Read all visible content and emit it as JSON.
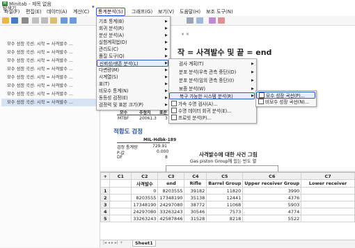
{
  "window": {
    "title": "Minitab - 제목 없음",
    "app_icon": "minitab-logo-icon"
  },
  "menu": [
    "파일(F)",
    "편집(E)",
    "데이터(A)",
    "계산(C)",
    "통계분석(S)",
    "그래프(G)",
    "보기(V)",
    "도움말(H)",
    "보조 도구(N)"
  ],
  "explorer": {
    "title": "탐색기",
    "items": [
      "모수 성장 곡선: 시작 = 사격발수 ...",
      "모수 성장 곡선: 시작 = 사격발수 ...",
      "모수 성장 곡선: 시작 = 사격발수 ...",
      "모수 성장 곡선: 시작 = 사격발수 ...",
      "모수 성장 곡선: 시작 = 사격발수 ...",
      "모수 성장 곡선: 시작 = 사격발수 ...",
      "모수 성장 곡선: 시작 = 사격발수 ...",
      "모수 성장 곡선: 시작 = 사격발수 ..."
    ],
    "selected_index": 7
  },
  "output": {
    "tab_close": "× ×",
    "heading": "작 = 사격발수 및 끝 = end",
    "mtbf_header": [
      "모수",
      "추정치",
      "표준"
    ],
    "mtbf_row": [
      "MTBF",
      "20061.3",
      "3"
    ],
    "trend_title": "적합도 검정",
    "test_name": "MIL-Hdbk-189",
    "stat_label": "검정 통계량",
    "stat_value": "729.91",
    "p_label": "P-값",
    "p_value": "0.000",
    "df_label": "DF",
    "df_value": "8",
    "chart_title": "사격발수에 대한 사건 그림",
    "chart_subtitle": "Gas piston Group에 있는 빈도 열"
  },
  "stat_menu": [
    "기초 통계(B)",
    "회귀 분석(R)",
    "분산 분석(A)",
    "실험계획법(D)",
    "관리도(C)",
    "품질 도구(Q)",
    "신뢰성/생존 분석(L)",
    "다변량(M)",
    "시계열(S)",
    "표(T)",
    "비모수 통계(N)",
    "동등성 검정(E)",
    "검정력 및 표본 크기(P)"
  ],
  "reliability_menu": [
    "검사 계획(T)",
    "분포 분석(우측 관측 중단)(D)",
    "분포 분석(임의 관측 중단)(I)",
    "보증 분석(W)",
    "복구 가능한 시스템 분석(R)",
    "가속 수명 검사(A)...",
    "수명 데이터 회귀 분석(E)...",
    "프로빗 분석(P)..."
  ],
  "repairable_menu": [
    "모수 성장 곡선(P)...",
    "비모수 성장 곡선(N)..."
  ],
  "worksheet": {
    "col_ids": [
      "C1",
      "C2",
      "C3",
      "C4",
      "C5",
      "C6",
      "C7"
    ],
    "col_names": [
      "",
      "사격발수",
      "end",
      "Rifle",
      "Barrel Group",
      "Upper receiver Group",
      "Lower receiver"
    ],
    "rows": [
      [
        "1",
        "",
        "0",
        "8203555",
        "39182",
        "11820",
        "3990"
      ],
      [
        "2",
        "",
        "8203555",
        "17348190",
        "35138",
        "12441",
        "4376"
      ],
      [
        "3",
        "",
        "17348190",
        "24297080",
        "38772",
        "11068",
        "5903"
      ],
      [
        "4",
        "",
        "24297080",
        "33263243",
        "30546",
        "7573",
        "4774"
      ],
      [
        "5",
        "",
        "33263243",
        "42587846",
        "31528",
        "8218",
        "5522"
      ]
    ],
    "sheet_nav": "|◂ ◂ ▸ ▸|  +",
    "sheet_tab": "Sheet1"
  },
  "colors": {
    "highlight_border": "#2a5bd7",
    "title_blue": "#2a55b0",
    "brand_green": "#2f8f3b"
  }
}
